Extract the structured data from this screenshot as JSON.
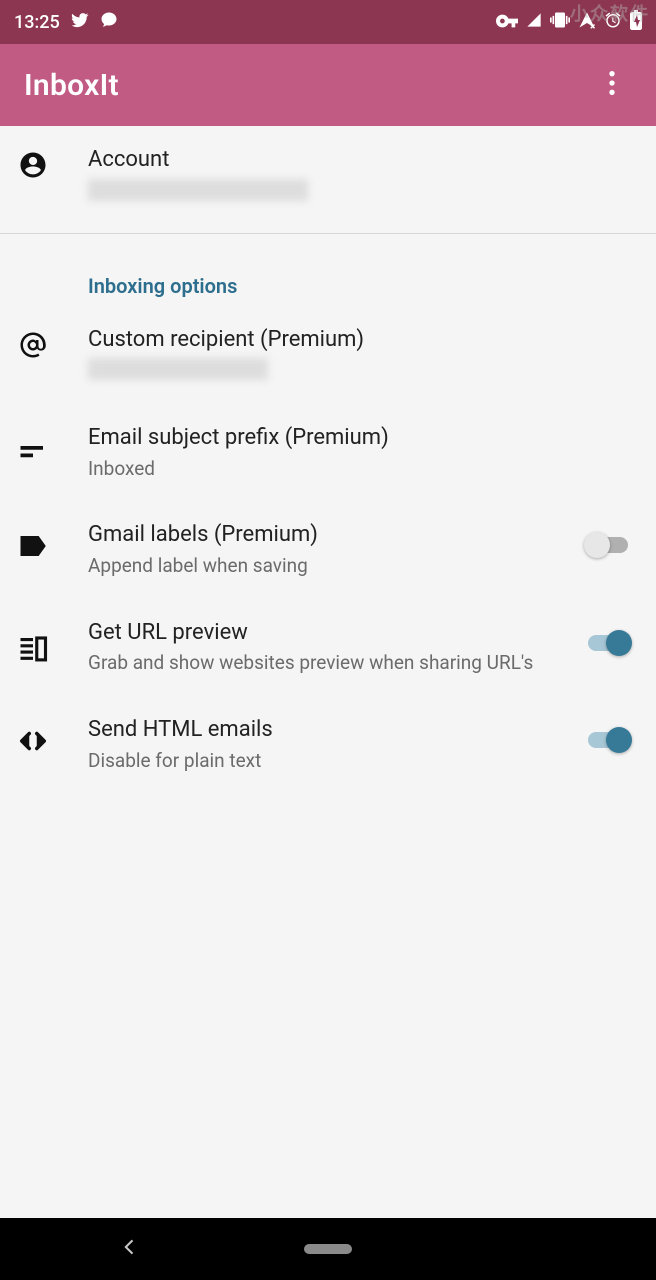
{
  "status": {
    "time": "13:25"
  },
  "appbar": {
    "title": "InboxIt"
  },
  "account": {
    "title": "Account"
  },
  "section": {
    "header": "Inboxing options"
  },
  "items": {
    "custom_recipient": {
      "title": "Custom recipient (Premium)"
    },
    "prefix": {
      "title": "Email subject prefix (Premium)",
      "subtitle": "Inboxed"
    },
    "labels": {
      "title": "Gmail labels (Premium)",
      "subtitle": "Append label when saving",
      "on": false
    },
    "preview": {
      "title": "Get URL preview",
      "subtitle": "Grab and show websites preview when sharing URL's",
      "on": true
    },
    "html": {
      "title": "Send HTML emails",
      "subtitle": "Disable for plain text",
      "on": true
    }
  },
  "watermark": "小众软件"
}
